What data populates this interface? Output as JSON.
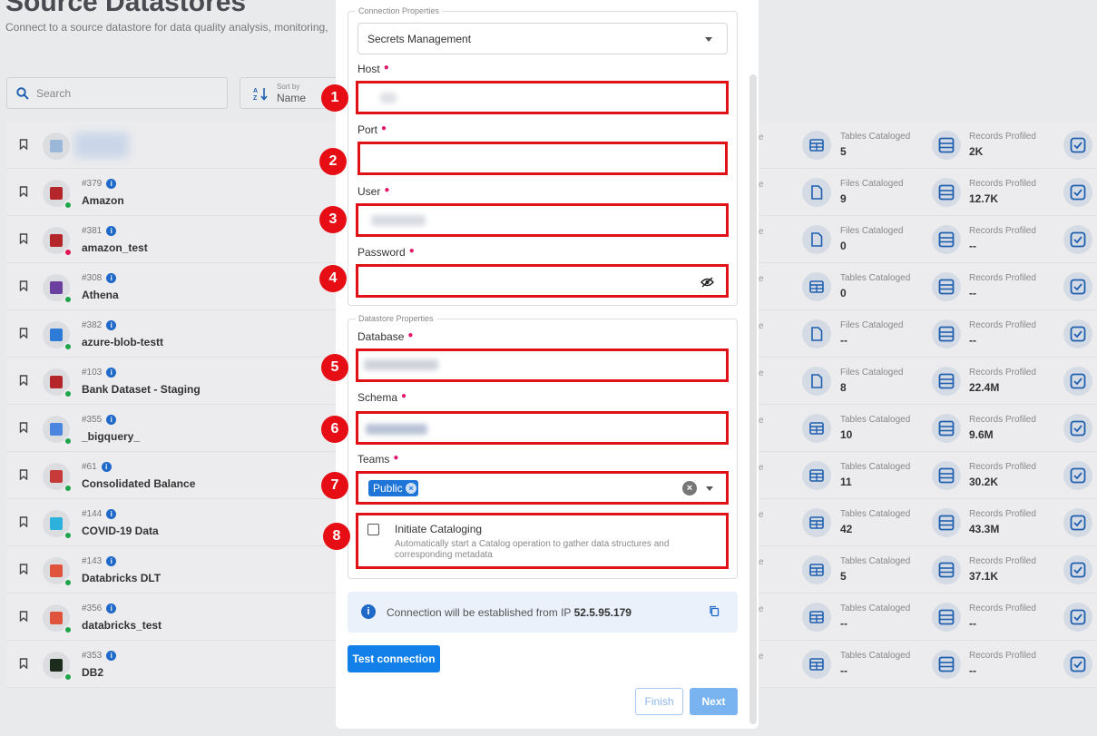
{
  "page": {
    "title": "Source Datastores",
    "subtitle": "Connect to a source datastore for data quality analysis, monitoring,"
  },
  "toolbar": {
    "search_placeholder": "Search",
    "sort_caption": "Sort by",
    "sort_value": "Name"
  },
  "datastores": [
    {
      "id": "",
      "name": "",
      "status": "none",
      "logo_color": "#9bb7d9",
      "metric1_label": "Tables Cataloged",
      "metric1_value": "5",
      "metric2_label": "Records Profiled",
      "metric2_value": "2K",
      "metric1_icon": "table-icon"
    },
    {
      "id": "#379",
      "name": "Amazon",
      "status": "green",
      "logo_color": "#b4262a",
      "metric1_label": "Files Cataloged",
      "metric1_value": "9",
      "metric2_label": "Records Profiled",
      "metric2_value": "12.7K",
      "metric1_icon": "file-icon"
    },
    {
      "id": "#381",
      "name": "amazon_test",
      "status": "red",
      "logo_color": "#b4262a",
      "metric1_label": "Files Cataloged",
      "metric1_value": "0",
      "metric2_label": "Records Profiled",
      "metric2_value": "--",
      "metric1_icon": "file-icon"
    },
    {
      "id": "#308",
      "name": "Athena",
      "status": "green",
      "logo_color": "#6a3fa0",
      "metric1_label": "Tables Cataloged",
      "metric1_value": "0",
      "metric2_label": "Records Profiled",
      "metric2_value": "--",
      "metric1_icon": "table-icon"
    },
    {
      "id": "#382",
      "name": "azure-blob-testt",
      "status": "green",
      "logo_color": "#2c7bd6",
      "metric1_label": "Files Cataloged",
      "metric1_value": "--",
      "metric2_label": "Records Profiled",
      "metric2_value": "--",
      "metric1_icon": "file-icon"
    },
    {
      "id": "#103",
      "name": "Bank Dataset - Staging",
      "status": "green",
      "logo_color": "#b4262a",
      "metric1_label": "Files Cataloged",
      "metric1_value": "8",
      "metric2_label": "Records Profiled",
      "metric2_value": "22.4M",
      "metric1_icon": "file-icon"
    },
    {
      "id": "#355",
      "name": "_bigquery_",
      "status": "green",
      "logo_color": "#4a86e0",
      "metric1_label": "Tables Cataloged",
      "metric1_value": "10",
      "metric2_label": "Records Profiled",
      "metric2_value": "9.6M",
      "metric1_icon": "table-icon"
    },
    {
      "id": "#61",
      "name": "Consolidated Balance",
      "status": "green",
      "logo_color": "#c63a3a",
      "metric1_label": "Tables Cataloged",
      "metric1_value": "11",
      "metric2_label": "Records Profiled",
      "metric2_value": "30.2K",
      "metric1_icon": "table-icon"
    },
    {
      "id": "#144",
      "name": "COVID-19 Data",
      "status": "green",
      "logo_color": "#2bb1dc",
      "metric1_label": "Tables Cataloged",
      "metric1_value": "42",
      "metric2_label": "Records Profiled",
      "metric2_value": "43.3M",
      "metric1_icon": "table-icon"
    },
    {
      "id": "#143",
      "name": "Databricks DLT",
      "status": "green",
      "logo_color": "#e0533c",
      "metric1_label": "Tables Cataloged",
      "metric1_value": "5",
      "metric2_label": "Records Profiled",
      "metric2_value": "37.1K",
      "metric1_icon": "table-icon"
    },
    {
      "id": "#356",
      "name": "databricks_test",
      "status": "green",
      "logo_color": "#e0533c",
      "metric1_label": "Tables Cataloged",
      "metric1_value": "--",
      "metric2_label": "Records Profiled",
      "metric2_value": "--",
      "metric1_icon": "table-icon"
    },
    {
      "id": "#353",
      "name": "DB2",
      "status": "green",
      "logo_color": "#1d2b1d",
      "metric1_label": "Tables Cataloged",
      "metric1_value": "--",
      "metric2_label": "Records Profiled",
      "metric2_value": "--",
      "metric1_icon": "table-icon"
    }
  ],
  "modal": {
    "connection_legend": "Connection Properties",
    "secrets_select": "Secrets Management",
    "host_label": "Host",
    "port_label": "Port",
    "user_label": "User",
    "password_label": "Password",
    "datastore_legend": "Datastore Properties",
    "database_label": "Database",
    "schema_label": "Schema",
    "teams_label": "Teams",
    "teams_chip": "Public",
    "cataloging_title": "Initiate Cataloging",
    "cataloging_desc": "Automatically start a Catalog operation to gather data structures and corresponding metadata",
    "ip_text": "Connection will be established from IP",
    "ip_value": "52.5.95.179",
    "test_button": "Test connection",
    "finish_button": "Finish",
    "next_button": "Next"
  },
  "annotations": [
    "1",
    "2",
    "3",
    "4",
    "5",
    "6",
    "7",
    "8"
  ],
  "colors": {
    "primary": "#1280e8",
    "highlight_red": "#e01218",
    "required": "#e2176a",
    "status_green": "#1ea54a",
    "status_red": "#e2175a"
  }
}
